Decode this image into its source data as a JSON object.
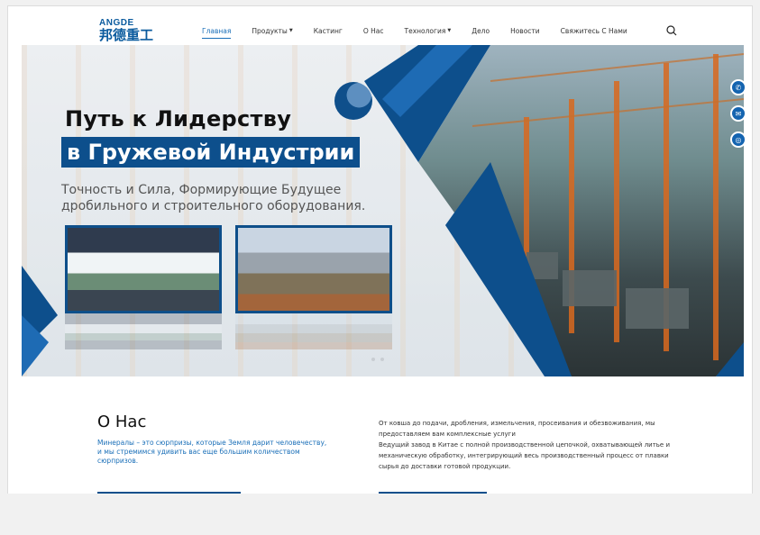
{
  "logo": {
    "en": "ANGDE",
    "cn": "邦德重工"
  },
  "nav": {
    "items": [
      {
        "label": "Главная",
        "active": true,
        "dropdown": false
      },
      {
        "label": "Продукты",
        "active": false,
        "dropdown": true
      },
      {
        "label": "Кастинг",
        "active": false,
        "dropdown": false
      },
      {
        "label": "О Нас",
        "active": false,
        "dropdown": false
      },
      {
        "label": "Технология",
        "active": false,
        "dropdown": true
      },
      {
        "label": "Дело",
        "active": false,
        "dropdown": false
      },
      {
        "label": "Новости",
        "active": false,
        "dropdown": false
      },
      {
        "label": "Свяжитесь С Нами",
        "active": false,
        "dropdown": false
      }
    ],
    "search_icon": "search-icon"
  },
  "hero": {
    "title_line1": "Путь к Лидерству",
    "title_line2": "в Гружевой Индустрии",
    "subtitle": "Точность и Сила, Формирующие Будущее дробильного и строительного оборудования."
  },
  "side_contacts": [
    "phone-icon",
    "mail-icon",
    "whatsapp-icon"
  ],
  "about": {
    "title": "О Нас",
    "subtitle": "Минералы – это сюрпризы, которые Земля дарит человечеству, и мы стремимся удивить вас еще большим количеством сюрпризов.",
    "text_line1": "От ковша до подачи, дробления, измельчения, просеивания и обезвоживания, мы предоставляем вам комплексные услуги",
    "text_line2": "Ведущий завод в Китае с полной производственной цепочкой, охватывающей литье и механическую обработку, интегрирующий весь производственный процесс от плавки сырья до доставки готовой продукции."
  },
  "colors": {
    "brand": "#0d4f8c",
    "accent": "#1a6fb8",
    "text": "#111111"
  }
}
